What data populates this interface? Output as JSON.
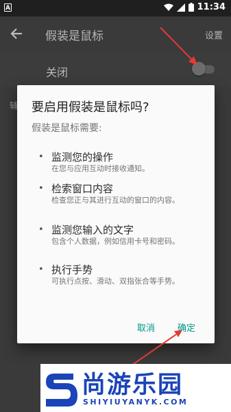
{
  "status_bar": {
    "time": "11:34",
    "app_icon": "A"
  },
  "app_bar": {
    "title": "假装是鼠标",
    "settings_label": "设置"
  },
  "switch_row": {
    "label": "关闭",
    "state": "off"
  },
  "background": {
    "cut_text": "辅"
  },
  "dialog": {
    "title": "要启用假装是鼠标吗?",
    "subtitle": "假装是鼠标需要:",
    "items": [
      {
        "bullet": "•",
        "title": "监测您的操作",
        "desc": "在您与应用互动时接收通知。"
      },
      {
        "bullet": "•",
        "title": "检索窗口内容",
        "desc": "检查您正与其进行互动的窗口的内容。"
      },
      {
        "bullet": "•",
        "title": "监测您输入的文字",
        "desc": "包含个人数据，例如信用卡号和密码。"
      },
      {
        "bullet": "•",
        "title": "执行手势",
        "desc": "可执行点按、滑动、双指张合等手势。"
      }
    ],
    "cancel_label": "取消",
    "ok_label": "确定"
  },
  "watermark": {
    "brand": "尚游乐园",
    "domain": "SHIYIUYANYK.COM"
  },
  "colors": {
    "accent": "#009688",
    "annotation": "#e53935",
    "brand": "#1a44b8"
  }
}
